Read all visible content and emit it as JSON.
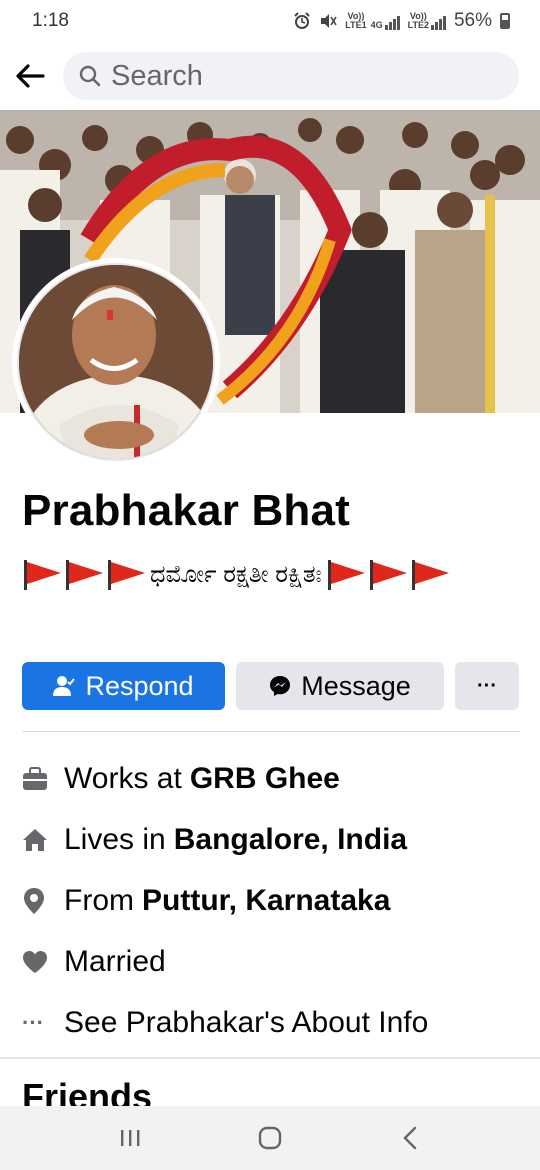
{
  "status_bar": {
    "time": "1:18",
    "sim1": "LTE1",
    "volte1": "Vo))",
    "net": "4G",
    "sim2": "LTE2",
    "volte2": "Vo))",
    "battery": "56%"
  },
  "search": {
    "placeholder": "Search"
  },
  "profile": {
    "name": "Prabhakar Bhat",
    "bio_text": "ಧರ್ಮೋ ರಕ್ಷತೀ ರಕ್ಷಿತಃ",
    "bio_flag_emoji": "triangular-flag-on-post"
  },
  "actions": {
    "respond_label": "Respond",
    "message_label": "Message",
    "more_label": "···"
  },
  "about": {
    "work_prefix": "Works at",
    "work_value": "GRB Ghee",
    "lives_prefix": "Lives in",
    "lives_value": "Bangalore, India",
    "from_prefix": "From",
    "from_value": "Puttur, Karnataka",
    "relationship": "Married",
    "see_about": "See Prabhakar's About Info"
  },
  "sections": {
    "friends_title": "Friends"
  },
  "colors": {
    "accent": "#1b74e4",
    "button_gray": "#e4e6eb",
    "flag_red": "#e0271b",
    "icon_gray": "#65676b"
  },
  "icons": {
    "back": "arrow-left-icon",
    "search": "search-icon",
    "work": "briefcase-icon",
    "home": "house-icon",
    "from": "location-pin-icon",
    "relationship": "heart-icon",
    "more": "ellipsis-icon"
  }
}
